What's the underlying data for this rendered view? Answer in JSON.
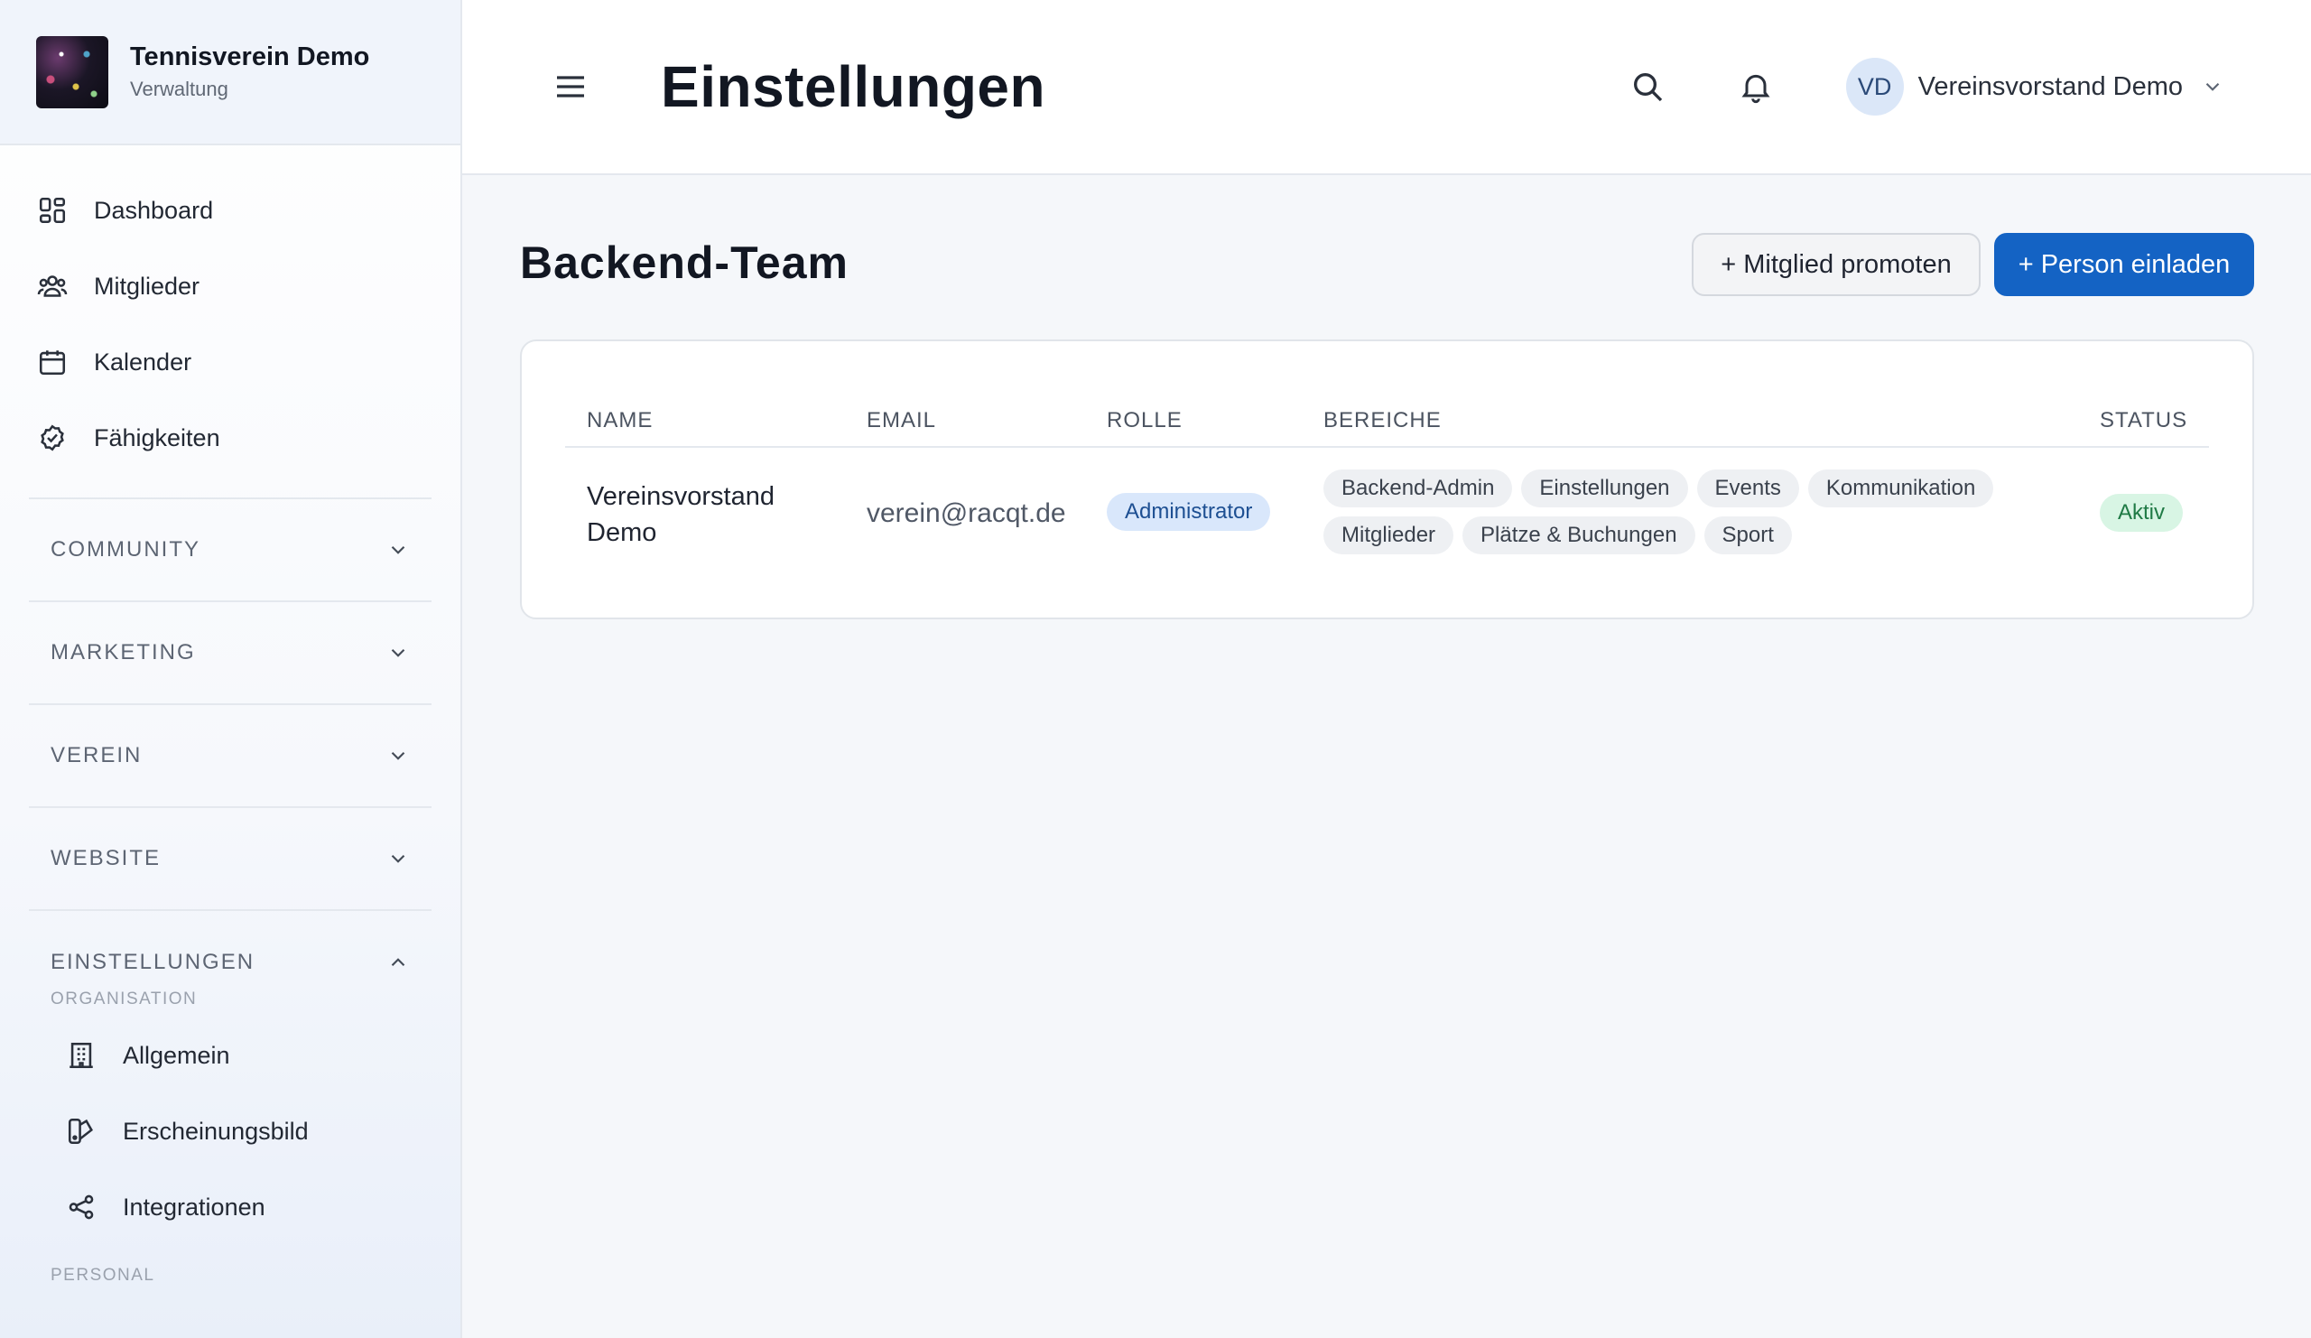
{
  "brand": {
    "name": "Tennisverein Demo",
    "subtitle": "Verwaltung"
  },
  "sidebar": {
    "top_items": [
      {
        "label": "Dashboard",
        "icon": "dashboard-icon"
      },
      {
        "label": "Mitglieder",
        "icon": "members-icon"
      },
      {
        "label": "Kalender",
        "icon": "calendar-icon"
      },
      {
        "label": "Fähigkeiten",
        "icon": "check-circle-icon"
      }
    ],
    "sections": [
      {
        "label": "COMMUNITY",
        "expanded": false
      },
      {
        "label": "MARKETING",
        "expanded": false
      },
      {
        "label": "VEREIN",
        "expanded": false
      },
      {
        "label": "WEBSITE",
        "expanded": false
      },
      {
        "label": "EINSTELLUNGEN",
        "expanded": true
      }
    ],
    "settings": {
      "group_organisation": "ORGANISATION",
      "items": [
        {
          "label": "Allgemein",
          "icon": "building-icon"
        },
        {
          "label": "Erscheinungsbild",
          "icon": "palette-icon"
        },
        {
          "label": "Integrationen",
          "icon": "share-icon"
        }
      ],
      "group_personal": "PERSONAL"
    }
  },
  "header": {
    "title": "Einstellungen",
    "user": {
      "initials": "VD",
      "name": "Vereinsvorstand Demo"
    }
  },
  "main": {
    "section_title": "Backend-Team",
    "buttons": {
      "promote": "+ Mitglied promoten",
      "invite": "+ Person einladen"
    },
    "table": {
      "headers": {
        "name": "NAME",
        "email": "EMAIL",
        "role": "ROLLE",
        "areas": "BEREICHE",
        "status": "STATUS"
      },
      "rows": [
        {
          "name": "Vereinsvorstand Demo",
          "email": "verein@racqt.de",
          "role": "Administrator",
          "areas": [
            "Backend-Admin",
            "Einstellungen",
            "Events",
            "Kommunikation",
            "Mitglieder",
            "Plätze & Buchungen",
            "Sport"
          ],
          "status": "Aktiv"
        }
      ]
    }
  },
  "colors": {
    "primary": "#1463c4",
    "role_pill_bg": "#d9e7fb",
    "status_pill_bg": "#d8f5e4",
    "status_pill_text": "#1f7a45"
  }
}
